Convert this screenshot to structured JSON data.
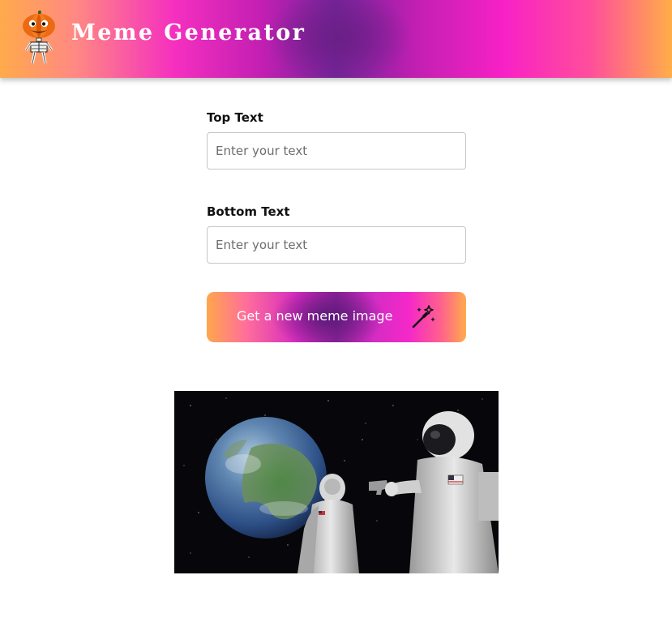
{
  "header": {
    "title": "Meme Generator",
    "logo_icon": "pumpkin-skeleton-icon"
  },
  "form": {
    "top_label": "Top Text",
    "top_placeholder": "Enter your text",
    "top_value": "",
    "bottom_label": "Bottom Text",
    "bottom_placeholder": "Enter your text",
    "bottom_value": ""
  },
  "button": {
    "label": "Get a new meme image",
    "icon": "magic-wand-icon"
  },
  "meme": {
    "icon": "astronauts-earth-meme-image"
  },
  "colors": {
    "gradient_orange": "#ffaa4a",
    "gradient_magenta": "#f52fc0",
    "gradient_purple": "#6a1f86"
  }
}
